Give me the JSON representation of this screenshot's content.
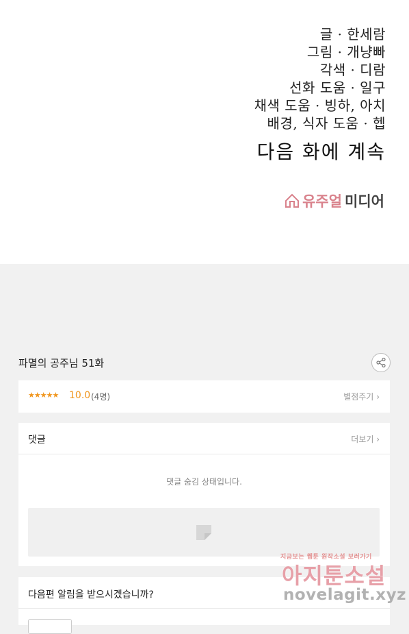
{
  "credits": {
    "lines": [
      "글 · 한세람",
      "그림 · 개냥빠",
      "각색 · 디람",
      "선화 도움 · 일구",
      "채색 도움 · 빙하, 아치",
      "배경, 식자 도움 ·  헵"
    ],
    "continue_text": "다음 화에 계속",
    "brand_name_pink": "유주얼",
    "brand_name_dark": "미디어"
  },
  "episode": {
    "title": "파멸의 공주님 51화"
  },
  "rating": {
    "stars": "★★★★★",
    "score": "10.0",
    "raters": "(4명)",
    "rate_link": "별점주기",
    "star_color": "#f0961e"
  },
  "comments": {
    "header": "댓글",
    "more_link": "더보기",
    "hidden_message": "댓글 숨김 상태입니다."
  },
  "alert": {
    "question": "다음편 알림을 받으시겠습니까?"
  },
  "watermark": {
    "tagline": "지금보는 웹툰 원작소설 보러가기",
    "site_name": "아지툰소설",
    "url": "novelagit.xyz"
  }
}
